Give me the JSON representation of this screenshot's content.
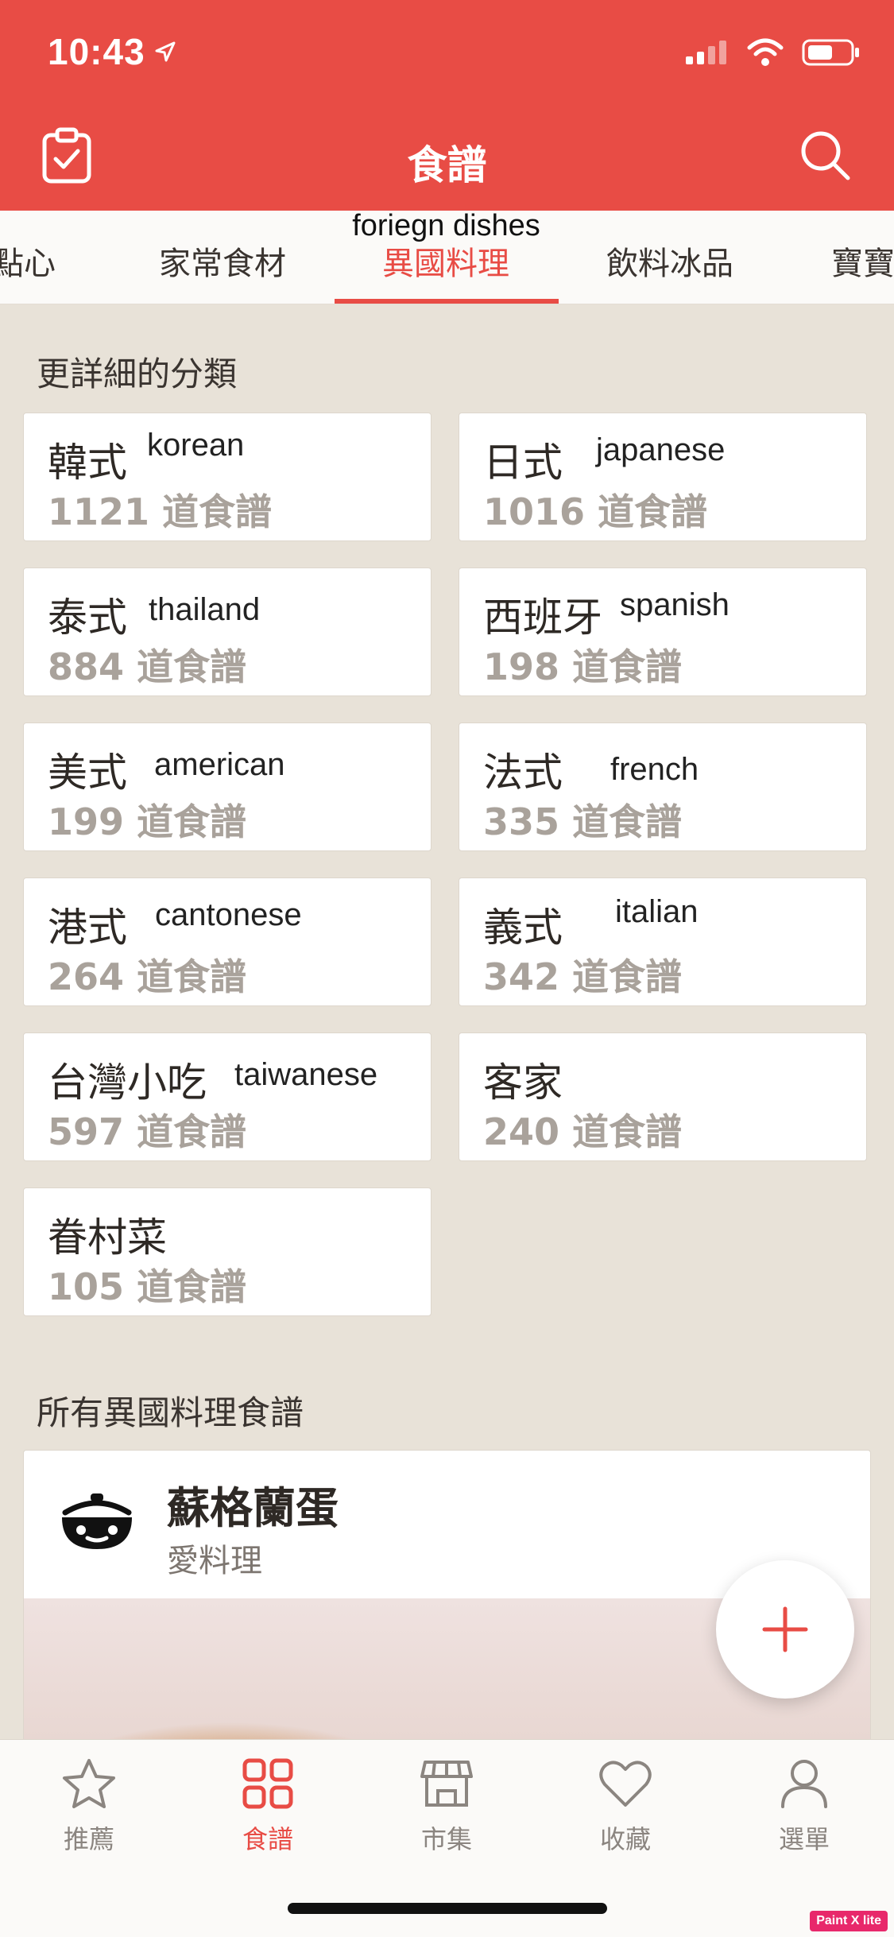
{
  "status": {
    "time": "10:43"
  },
  "header": {
    "title": "食譜"
  },
  "tabs": [
    {
      "label": "點心"
    },
    {
      "label": "家常食材"
    },
    {
      "label": "異國料理",
      "note": "foriegn dishes"
    },
    {
      "label": "飲料冰品"
    },
    {
      "label": "寶寶"
    }
  ],
  "subcategory_title": "更詳細的分類",
  "categories": [
    {
      "name": "韓式",
      "eng": "korean",
      "count": "1121 道食譜"
    },
    {
      "name": "日式",
      "eng": "japanese",
      "count": "1016 道食譜"
    },
    {
      "name": "泰式",
      "eng": "thailand",
      "count": "884 道食譜"
    },
    {
      "name": "西班牙",
      "eng": "spanish",
      "count": "198 道食譜"
    },
    {
      "name": "美式",
      "eng": "american",
      "count": "199 道食譜"
    },
    {
      "name": "法式",
      "eng": "french",
      "count": "335 道食譜"
    },
    {
      "name": "港式",
      "eng": "cantonese",
      "count": "264 道食譜"
    },
    {
      "name": "義式",
      "eng": "italian",
      "count": "342 道食譜"
    },
    {
      "name": "台灣小吃",
      "eng": "taiwanese",
      "count": "597 道食譜"
    },
    {
      "name": "客家",
      "eng": "",
      "count": "240 道食譜"
    },
    {
      "name": "眷村菜",
      "eng": "",
      "count": "105 道食譜"
    }
  ],
  "all_title": "所有異國料理食譜",
  "recipe": {
    "title": "蘇格蘭蛋",
    "author": "愛料理"
  },
  "bottom_nav": [
    {
      "label": "推薦",
      "icon": "star-icon"
    },
    {
      "label": "食譜",
      "icon": "grid-icon"
    },
    {
      "label": "市集",
      "icon": "store-icon"
    },
    {
      "label": "收藏",
      "icon": "heart-icon"
    },
    {
      "label": "選單",
      "icon": "profile-icon"
    }
  ],
  "badge": "Paint X lite",
  "colors": {
    "accent": "#e84c45",
    "background": "#e8e2d8"
  }
}
